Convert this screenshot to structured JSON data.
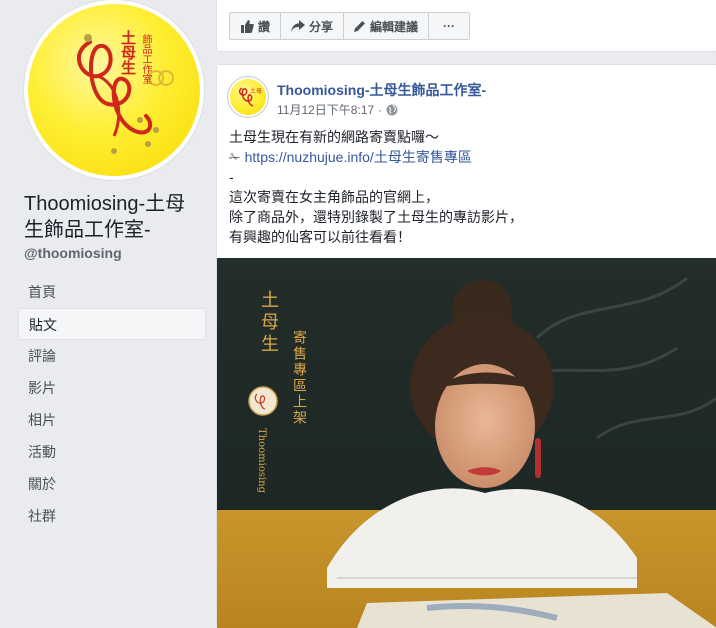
{
  "page": {
    "name": "Thoomiosing-土母生飾品工作室-",
    "handle": "@thoomiosing",
    "logo_text": "土母生飾品工作室"
  },
  "nav": {
    "items": [
      {
        "label": "首頁",
        "active": false
      },
      {
        "label": "貼文",
        "active": true
      },
      {
        "label": "評論",
        "active": false
      },
      {
        "label": "影片",
        "active": false
      },
      {
        "label": "相片",
        "active": false
      },
      {
        "label": "活動",
        "active": false
      },
      {
        "label": "關於",
        "active": false
      },
      {
        "label": "社群",
        "active": false
      }
    ]
  },
  "top_actions": {
    "like": "讚",
    "share": "分享",
    "edit": "編輯建議",
    "more": "···"
  },
  "post": {
    "author": "Thoomiosing-土母生飾品工作室-",
    "timestamp": "11月12日下午8:17",
    "lines": {
      "l1": "土母生現在有新的網路寄賣點囉～",
      "l2_prefix": "✁ ",
      "l2_link": "https://nuzhujue.info/土母生寄售專區",
      "l3": "-",
      "l4": "這次寄賣在女主角飾品的官網上，",
      "l5": "除了商品外，還特別錄製了土母生的專訪影片，",
      "l6": "有興趣的仙客可以前往看看！"
    },
    "image": {
      "brand_vertical": "土母生",
      "brand_latin": "Thoomiosing",
      "headline_vertical": "寄售專區上架"
    }
  },
  "colors": {
    "background": "#e9ebee",
    "link": "#365899",
    "logo_yellow": "#ffee33",
    "logo_red": "#d0271d",
    "photo_text": "#d9a74a"
  }
}
